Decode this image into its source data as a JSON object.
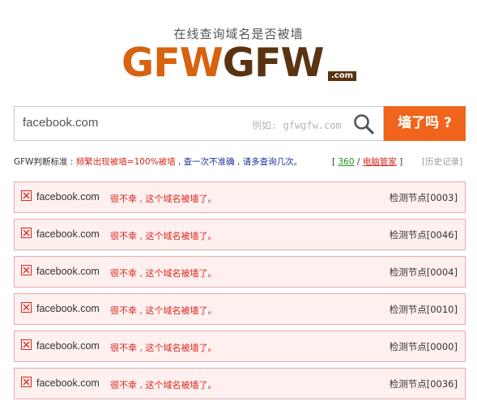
{
  "header": {
    "tagline": "在线查询域名是否被墙",
    "logo": {
      "part1": "GFW",
      "part2": "GFW",
      "suffix": ".com"
    }
  },
  "search": {
    "value": "facebook.com",
    "placeholder": "例如: gfwgfw.com",
    "button_label": "墙了吗 ?"
  },
  "criteria": {
    "label": "GFW判断标准 :",
    "rule_red": "频繁出现被墙=100%被墙",
    "sep": " , ",
    "rule_blue": "查一次不准确 , 请多查询几次。",
    "bracket_open": "[",
    "link_360": "360",
    "slash": "/",
    "link_pcmgr": "电脑管家",
    "bracket_close": "]",
    "history": "[历史记录]"
  },
  "colors": {
    "accent_orange": "#f0641c",
    "logo_orange": "#d7620f",
    "logo_brown": "#5a3310",
    "blocked_red": "#d9261c"
  },
  "results": [
    {
      "domain": "facebook.com",
      "message": "很不幸 , 这个域名被墙了。",
      "node": "检测节点[0003]"
    },
    {
      "domain": "facebook.com",
      "message": "很不幸 , 这个域名被墙了。",
      "node": "检测节点[0046]"
    },
    {
      "domain": "facebook.com",
      "message": "很不幸 , 这个域名被墙了。",
      "node": "检测节点[0004]"
    },
    {
      "domain": "facebook.com",
      "message": "很不幸 , 这个域名被墙了。",
      "node": "检测节点[0010]"
    },
    {
      "domain": "facebook.com",
      "message": "很不幸 , 这个域名被墙了。",
      "node": "检测节点[0000]"
    },
    {
      "domain": "facebook.com",
      "message": "很不幸 , 这个域名被墙了。",
      "node": "检测节点[0036]"
    }
  ]
}
